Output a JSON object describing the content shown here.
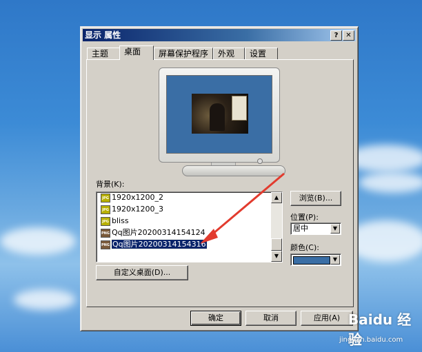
{
  "window": {
    "title": "显示 属性",
    "help_button": "?",
    "close_button": "✕"
  },
  "tabs": [
    {
      "label": "主题",
      "active": false
    },
    {
      "label": "桌面",
      "active": true
    },
    {
      "label": "屏幕保护程序",
      "active": false
    },
    {
      "label": "外观",
      "active": false
    },
    {
      "label": "设置",
      "active": false
    }
  ],
  "background": {
    "label": "背景(K):",
    "items": [
      {
        "name": "1920x1200_2",
        "icon": "jpg-file-icon",
        "icon_text": "JPG",
        "selected": false
      },
      {
        "name": "1920x1200_3",
        "icon": "jpg-file-icon",
        "icon_text": "JPG",
        "selected": false
      },
      {
        "name": "bliss",
        "icon": "jpg-file-icon",
        "icon_text": "JPG",
        "selected": false
      },
      {
        "name": "Qq图片20200314154124",
        "icon": "png-file-icon",
        "icon_text": "PNG",
        "selected": false
      },
      {
        "name": "Qq图片20200314154316",
        "icon": "png-file-icon",
        "icon_text": "PNG",
        "selected": true
      }
    ]
  },
  "browse_button": "浏览(B)...",
  "position": {
    "label": "位置(P):",
    "value": "居中"
  },
  "color": {
    "label": "颜色(C):",
    "value": "#3a6ea5"
  },
  "customize_button": "自定义桌面(D)...",
  "footer": {
    "ok": "确定",
    "cancel": "取消",
    "apply": "应用(A)"
  },
  "watermark": {
    "brand": "Baidu 经验",
    "url": "jingyan.baidu.com"
  },
  "colors": {
    "desktop_sky": "#3c8bd6",
    "dialog_face": "#d4d0c8",
    "titlebar": "#0a246a",
    "annotation_arrow": "#e23b2e"
  }
}
